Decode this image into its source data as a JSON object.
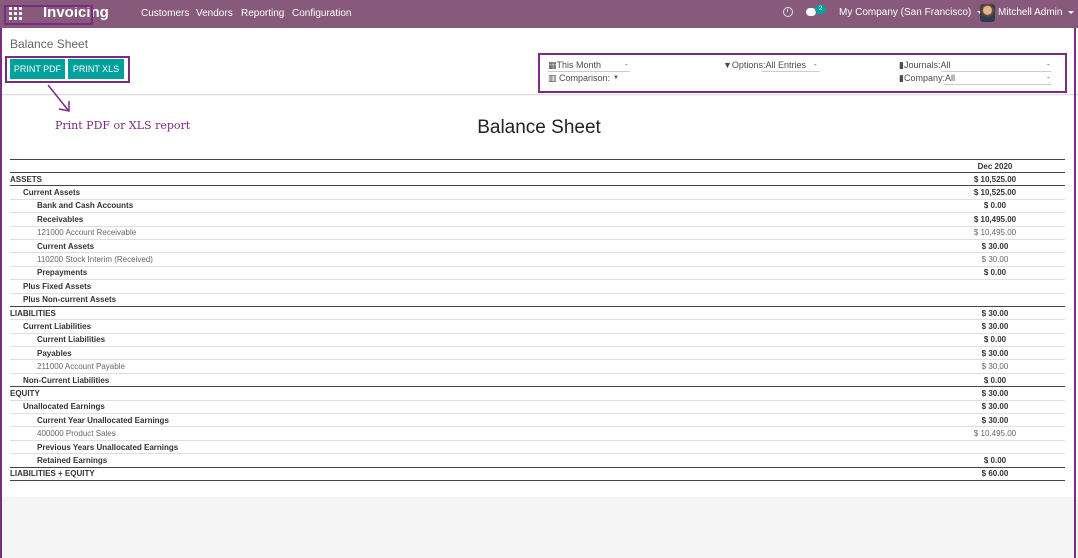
{
  "navbar": {
    "app_name": "Invoicing",
    "menu": [
      "Customers",
      "Vendors",
      "Reporting",
      "Configuration"
    ],
    "chat_badge": "2",
    "company": "My Company (San Francisco)",
    "user": "Mitchell Admin"
  },
  "breadcrumb": "Balance Sheet",
  "buttons": {
    "print_pdf": "PRINT PDF",
    "print_xls": "PRINT XLS"
  },
  "filters": {
    "date": "This Month",
    "options": "Options:",
    "options_value": "All Entries",
    "journals": "Journals:",
    "journals_value": "All",
    "comparison": "Comparison:",
    "company": "Company:",
    "company_value": "All"
  },
  "annotation": "Print PDF or XLS report",
  "report": {
    "title": "Balance Sheet",
    "column_header": "Dec 2020",
    "rows": [
      {
        "label": "ASSETS",
        "amount": "$ 10,525.00"
      },
      {
        "label": "Current Assets",
        "amount": "$ 10,525.00"
      },
      {
        "label": "Bank and Cash Accounts",
        "amount": "$ 0.00"
      },
      {
        "label": "Receivables",
        "amount": "$ 10,495.00"
      },
      {
        "label": "121000 Account Receivable",
        "amount": "$   10,495.00"
      },
      {
        "label": "Current Assets",
        "amount": "$ 30.00"
      },
      {
        "label": "110200 Stock Interim (Received)",
        "amount": "$   30.00"
      },
      {
        "label": "Prepayments",
        "amount": "$ 0.00"
      },
      {
        "label": "Plus Fixed Assets",
        "amount": ""
      },
      {
        "label": "Plus Non-current Assets",
        "amount": ""
      },
      {
        "label": "LIABILITIES",
        "amount": "$ 30.00"
      },
      {
        "label": "Current Liabilities",
        "amount": "$ 30.00"
      },
      {
        "label": "Current Liabilities",
        "amount": "$ 0.00"
      },
      {
        "label": "Payables",
        "amount": "$ 30.00"
      },
      {
        "label": "211000 Account Payable",
        "amount": "$   30.00"
      },
      {
        "label": "Non-Current Liabilities",
        "amount": "$ 0.00"
      },
      {
        "label": "EQUITY",
        "amount": "$ 30.00"
      },
      {
        "label": "Unallocated Earnings",
        "amount": "$ 30.00"
      },
      {
        "label": "Current Year Unallocated Earnings",
        "amount": "$ 30.00"
      },
      {
        "label": "400000 Product Sales",
        "amount": "$   10,495.00"
      },
      {
        "label": "Previous Years Unallocated Earnings",
        "amount": ""
      },
      {
        "label": "Retained Earnings",
        "amount": "$ 0.00"
      },
      {
        "label": "LIABILITIES + EQUITY",
        "amount": "$ 60.00"
      }
    ]
  }
}
